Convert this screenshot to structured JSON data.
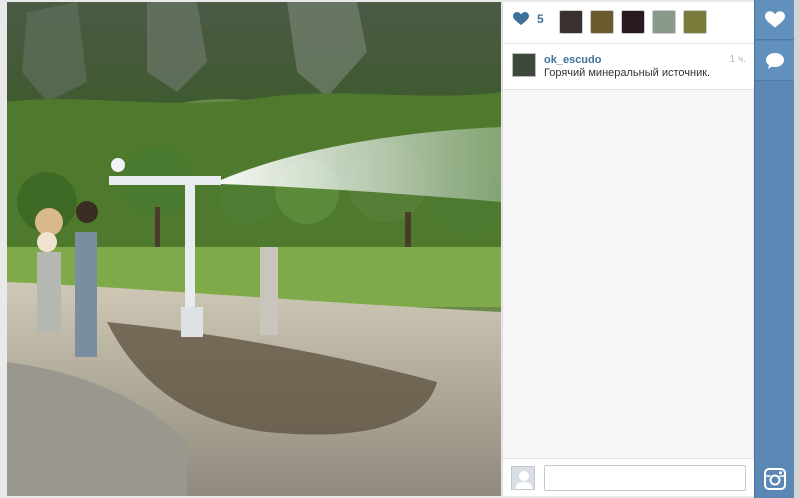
{
  "post": {
    "likes_count": "5",
    "username": "ok_escudo",
    "time_ago": "1 ч.",
    "caption": "Горячий минеральный источник."
  },
  "comment": {
    "placeholder": ""
  },
  "icons": {
    "like": "heart-icon",
    "comment": "speech-bubble-icon",
    "instagram": "instagram-camera-icon"
  },
  "colors": {
    "accent": "#3f729b",
    "sidebar": "#5a87b3",
    "panel": "#f7f7f7"
  }
}
